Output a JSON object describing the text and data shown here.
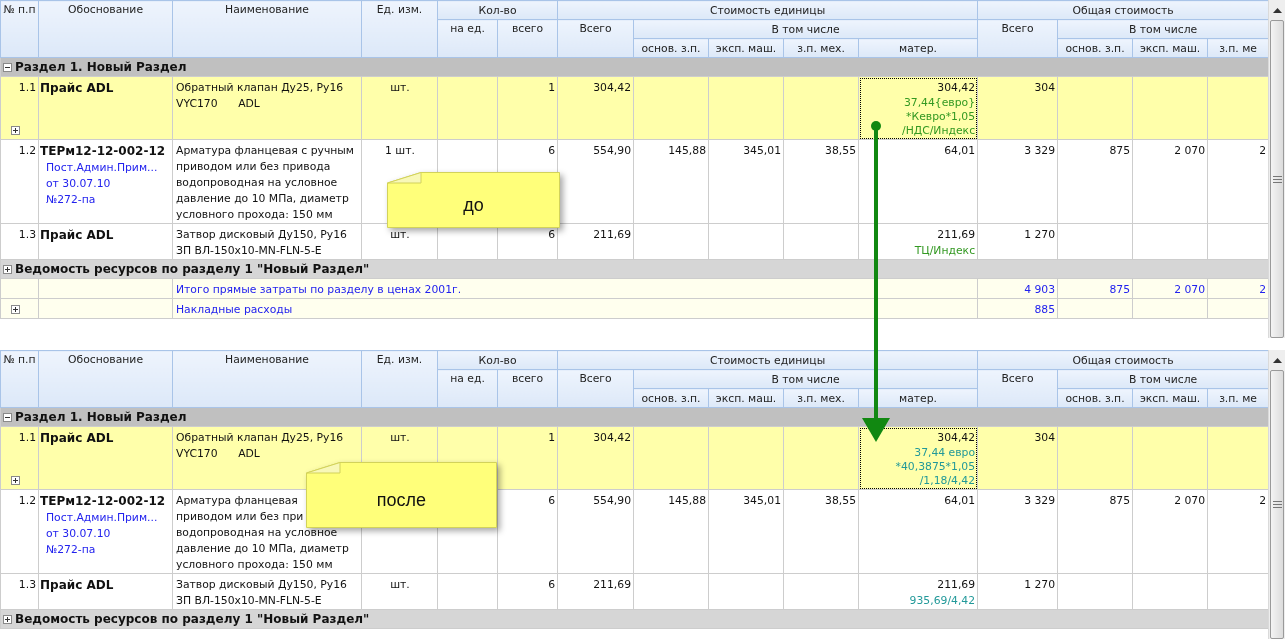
{
  "panels": [
    {
      "note": "до",
      "header": {
        "number": "№ п.п",
        "basis": "Обоснование",
        "name": "Наименование",
        "unit": "Ед. изм.",
        "qty": {
          "title": "Кол-во",
          "per_unit": "на ед.",
          "total": "всего"
        },
        "unit_cost": {
          "title": "Стоимость единицы",
          "total": "Всего",
          "including": "В том числе",
          "parts": [
            "основ. з.п.",
            "эксп. маш.",
            "з.п. мех.",
            "матер."
          ]
        },
        "total_cost": {
          "title": "Общая стоимость",
          "total": "Всего",
          "including": "В том числе",
          "parts": [
            "основ. з.п.",
            "эксп. маш.",
            "з.п. ме"
          ]
        }
      },
      "rows": [
        {
          "kind": "section",
          "label": "Раздел 1. Новый Раздел",
          "expanded": true
        },
        {
          "kind": "item",
          "number": "1.1",
          "basis": "Прайс ADL",
          "name": [
            "Обратный клапан Ду25, Ру16",
            "VYC170      ADL"
          ],
          "unit": "шт.",
          "qty_total": "1",
          "price": "304,42",
          "material": "304,42",
          "material_note": {
            "lines": [
              "37,44{евро}",
              "*Кевро*1,05",
              "/НДС/Индекс"
            ],
            "kind": "symbolic"
          },
          "cost_total": "304",
          "highlighted": true,
          "expandable": true,
          "focused": true
        },
        {
          "kind": "item",
          "number": "1.2",
          "basis": "ТЕРм12-12-002-12",
          "basis_note": [
            "Пост.Админ.Прим...",
            "от 30.07.10",
            "№272-па"
          ],
          "name": [
            "Арматура фланцевая с ручным",
            "приводом или без привода",
            "водопроводная на условное",
            "давление до 10 МПа, диаметр",
            "условного прохода: 150 мм"
          ],
          "unit": "1 шт.",
          "qty_total": "6",
          "price": "554,90",
          "wage": "145,88",
          "machine": "345,01",
          "mech": "38,55",
          "material": "64,01",
          "cost_total": "3 329",
          "cost_wage": "875",
          "cost_machine": "2 070",
          "cost_mech": "2",
          "highlighted": false,
          "expandable": false,
          "focused": false
        },
        {
          "kind": "item",
          "number": "1.3",
          "basis": "Прайс ADL",
          "name": [
            "Затвор дисковый Ду150, Ру16",
            "ЗП ВЛ-150x10-MN-FLN-5-E"
          ],
          "unit": "шт.",
          "qty_total": "6",
          "price": "211,69",
          "material": "211,69",
          "material_note": {
            "lines": [
              "ТЦ/Индекс"
            ],
            "kind": "symbolic"
          },
          "cost_total": "1 270",
          "highlighted": false,
          "expandable": false,
          "focused": false
        },
        {
          "kind": "section",
          "label": "Ведомость ресурсов по разделу 1 \"Новый Раздел\"",
          "expanded": false
        },
        {
          "kind": "total",
          "label": "Итого прямые затраты по разделу в ценах 2001г.",
          "cost_total": "4 903",
          "cost_wage": "875",
          "cost_machine": "2 070",
          "cost_mech": "2",
          "expandable": false
        },
        {
          "kind": "total",
          "label": "Накладные расходы",
          "cost_total": "885",
          "expandable": true
        }
      ]
    },
    {
      "note": "после",
      "header": {
        "number": "№ п.п",
        "basis": "Обоснование",
        "name": "Наименование",
        "unit": "Ед. изм.",
        "qty": {
          "title": "Кол-во",
          "per_unit": "на ед.",
          "total": "всего"
        },
        "unit_cost": {
          "title": "Стоимость единицы",
          "total": "Всего",
          "including": "В том числе",
          "parts": [
            "основ. з.п.",
            "эксп. маш.",
            "з.п. мех.",
            "матер."
          ]
        },
        "total_cost": {
          "title": "Общая стоимость",
          "total": "Всего",
          "including": "В том числе",
          "parts": [
            "основ. з.п.",
            "эксп. маш.",
            "з.п. ме"
          ]
        }
      },
      "rows": [
        {
          "kind": "section",
          "label": "Раздел 1. Новый Раздел",
          "expanded": true
        },
        {
          "kind": "item",
          "number": "1.1",
          "basis": "Прайс ADL",
          "name": [
            "Обратный клапан Ду25, Ру16",
            "VYC170      ADL"
          ],
          "unit": "шт.",
          "qty_total": "1",
          "price": "304,42",
          "material": "304,42",
          "material_note": {
            "lines": [
              "37,44 евро",
              "*40,3875*1,05",
              "/1,18/4,42"
            ],
            "kind": "numeric"
          },
          "cost_total": "304",
          "highlighted": true,
          "expandable": true,
          "focused": true
        },
        {
          "kind": "item",
          "number": "1.2",
          "basis": "ТЕРм12-12-002-12",
          "basis_note": [
            "Пост.Админ.Прим...",
            "от 30.07.10",
            "№272-па"
          ],
          "name": [
            "Арматура фланцевая",
            "приводом или без при",
            "водопроводная на условное",
            "давление до 10 МПа, диаметр",
            "условного прохода: 150 мм"
          ],
          "qty_total": "6",
          "price": "554,90",
          "wage": "145,88",
          "machine": "345,01",
          "mech": "38,55",
          "material": "64,01",
          "cost_total": "3 329",
          "cost_wage": "875",
          "cost_machine": "2 070",
          "cost_mech": "2",
          "highlighted": false,
          "expandable": false,
          "focused": false
        },
        {
          "kind": "item",
          "number": "1.3",
          "basis": "Прайс ADL",
          "name": [
            "Затвор дисковый Ду150, Ру16",
            "ЗП ВЛ-150x10-MN-FLN-5-E"
          ],
          "unit": "шт.",
          "qty_total": "6",
          "price": "211,69",
          "material": "211,69",
          "material_note": {
            "lines": [
              "935,69/4,42"
            ],
            "kind": "numeric"
          },
          "cost_total": "1 270",
          "highlighted": false,
          "expandable": false,
          "focused": false
        },
        {
          "kind": "section",
          "label": "Ведомость ресурсов по разделу 1 \"Новый Раздел\"",
          "expanded": false
        }
      ]
    }
  ]
}
